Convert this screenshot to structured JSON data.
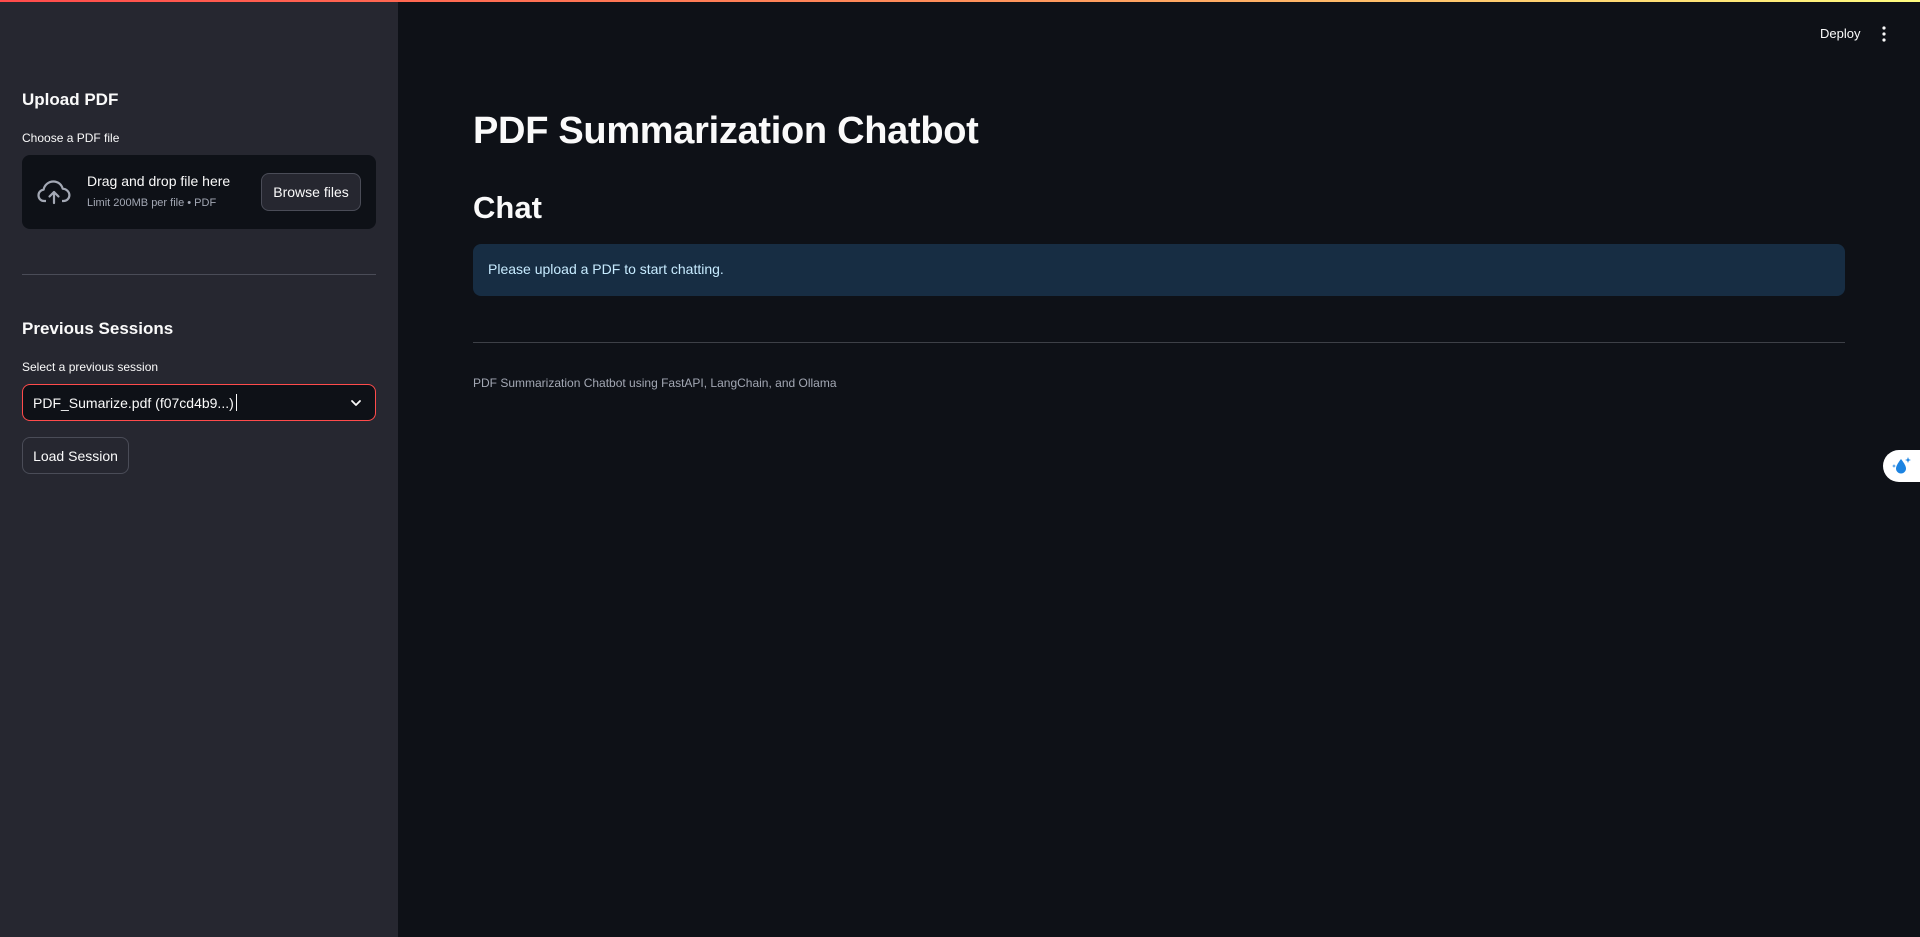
{
  "header": {
    "deploy_label": "Deploy",
    "menu_icon": "vertical-dots-icon"
  },
  "sidebar": {
    "upload": {
      "heading": "Upload PDF",
      "label": "Choose a PDF file",
      "dropzone_title": "Drag and drop file here",
      "dropzone_subtitle": "Limit 200MB per file • PDF",
      "browse_label": "Browse files",
      "icon": "cloud-upload-icon"
    },
    "sessions": {
      "heading": "Previous Sessions",
      "label": "Select a previous session",
      "selected_value": "PDF_Sumarize.pdf (f07cd4b9...)",
      "load_label": "Load Session"
    }
  },
  "main": {
    "title": "PDF Summarization Chatbot",
    "chat_heading": "Chat",
    "info_message": "Please upload a PDF to start chatting.",
    "footer": "PDF Summarization Chatbot using FastAPI, LangChain, and Ollama"
  },
  "colors": {
    "background": "#0e1117",
    "sidebar": "#262730",
    "accent": "#ff4b4b",
    "info_bg": "#172d43",
    "info_text": "#c7ebff"
  }
}
